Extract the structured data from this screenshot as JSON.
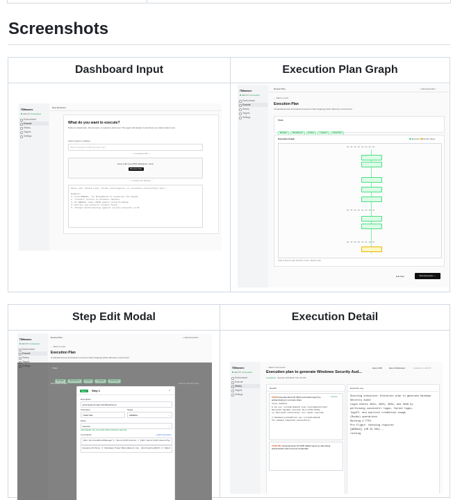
{
  "section": {
    "title": "Screenshots"
  },
  "columns": {
    "dashboard_input": "Dashboard Input",
    "execution_plan_graph": "Execution Plan Graph",
    "step_edit_modal": "Step Edit Modal",
    "execution_detail": "Execution Detail"
  },
  "app": {
    "logo": "⊓Maxsec",
    "status": "UECTX",
    "status_sub": "Connected",
    "nav": [
      "Environment",
      "Execute",
      "History",
      "Targets",
      "Settings"
    ]
  },
  "dashboard": {
    "page_label": "New Execution",
    "title": "What do you want to execute?",
    "intro": "Paste an attack plan, threat report, or upload a document. The agent will analyze it and show you what it plans to do.",
    "url_label": "Link to report or writeup",
    "url_placeholder": "https://example.com/threat-report.html",
    "or_upload": "— or upload a file —",
    "drop_text": "Drop a file here (PDF, Markdown, Text)",
    "browse_label": "Browse Files",
    "or_paste": "— or paste text directly —",
    "paste_lines": [
      "Paste your attack plan, threat intelligence, or execution instructions here...",
      "",
      "Example:",
      "1. From WEB01A, run BloodHound to enumerate the domain",
      "2. Transfer results to Attacker machine",
      "3. On WEB01A, dump LSASS memory using ProcDump",
      "4. Extract any Kerberos tickets found",
      "5. Attempt Kerberoasting against service accounts on DC"
    ]
  },
  "plan": {
    "page_label": "Review Plan",
    "new_execution": "+ New Execution",
    "back": "← Back to input",
    "title": "Execution Plan",
    "subtitle": "Credential access and lateral movement chain targeting Active Directory environment",
    "tools_label": "Tools",
    "tools": [
      "Mimikatz",
      "BloodHound",
      "Rubeus",
      "Impacket",
      "PowerView"
    ],
    "graph_label": "Execution Graph",
    "legend": [
      "Execute",
      "Decide",
      "Steps"
    ],
    "graph_caption": "Click a step to edit. Scroll to zoom, drag to pan.",
    "edit_plan": "Edit Plan",
    "start_execution": "Start Execution →"
  },
  "modal": {
    "step_badge": "Step 1",
    "step_title": "Step 1",
    "description_label": "Description",
    "description_value": "Enumerate domain with Bloodhound",
    "technique_label": "Technique",
    "technique_value": "T1087.002",
    "target_label": "Target",
    "target_value": "WEB01A",
    "mode_label": "Mode",
    "mode_value": "Execute",
    "mode_hint": "Automatically runs commands without asking for approval",
    "commands_label": "Commands",
    "add_command": "+ Add Command",
    "cmd_lines": [
      "[Net.ServicePointManager]::SecurityProtocol = [Net.SecurityProtocolType]::Tls12",
      "Expand-Archive C:\\Windows\\Temp\\SharpHound.zip -DestinationPath C:\\Windows\\Temp"
    ]
  },
  "detail": {
    "back": "← Back to Execution",
    "title": "Execution plan to generate Windows Security Aud...",
    "status": "completed",
    "started": "Started 3/13/2026, 8:01:22 PM",
    "export_md": "Export MD",
    "export_markdown": "Export Markdown",
    "updated": "Updated to UECTX",
    "results_label": "Results",
    "log_label": "Execution Log",
    "result1_code": "T1078",
    "result1_title": "Generate Event ID 4624 (successful logon) by authenticating to a remote share",
    "result1_badge": "success",
    "result1_target": "Target: WEB01A",
    "result1_output": [
      "$ net use \\\\corpdc\\admin$ /user:corp\\Administrator",
      "Microsoft Windows [Version 10.0.17763.5576]",
      "(c) Microsoft Corporation. All rights reserved.",
      "",
      "C:\\Windows\\system32>net use \\\\corpdc\\admin$",
      "The command completed successfully."
    ],
    "result2_code": "T1110.001",
    "result2_title": "Generate Event ID 4625 (failed logon) by attempting authentication with incorrect credentials",
    "log_lines": [
      "Starting execution: Execution plan to generate Windows Security Audit",
      "Logon events 4624, 4625, 4634, and 4648 by",
      "performing successful logon, failed logon,",
      "logoff, and explicit credential usage",
      "(RunAs) operations",
      "Running 4 TTPs",
      "Pre-flight: checking required",
      "[WEB01A] (VM ID 205) —",
      "running"
    ]
  }
}
